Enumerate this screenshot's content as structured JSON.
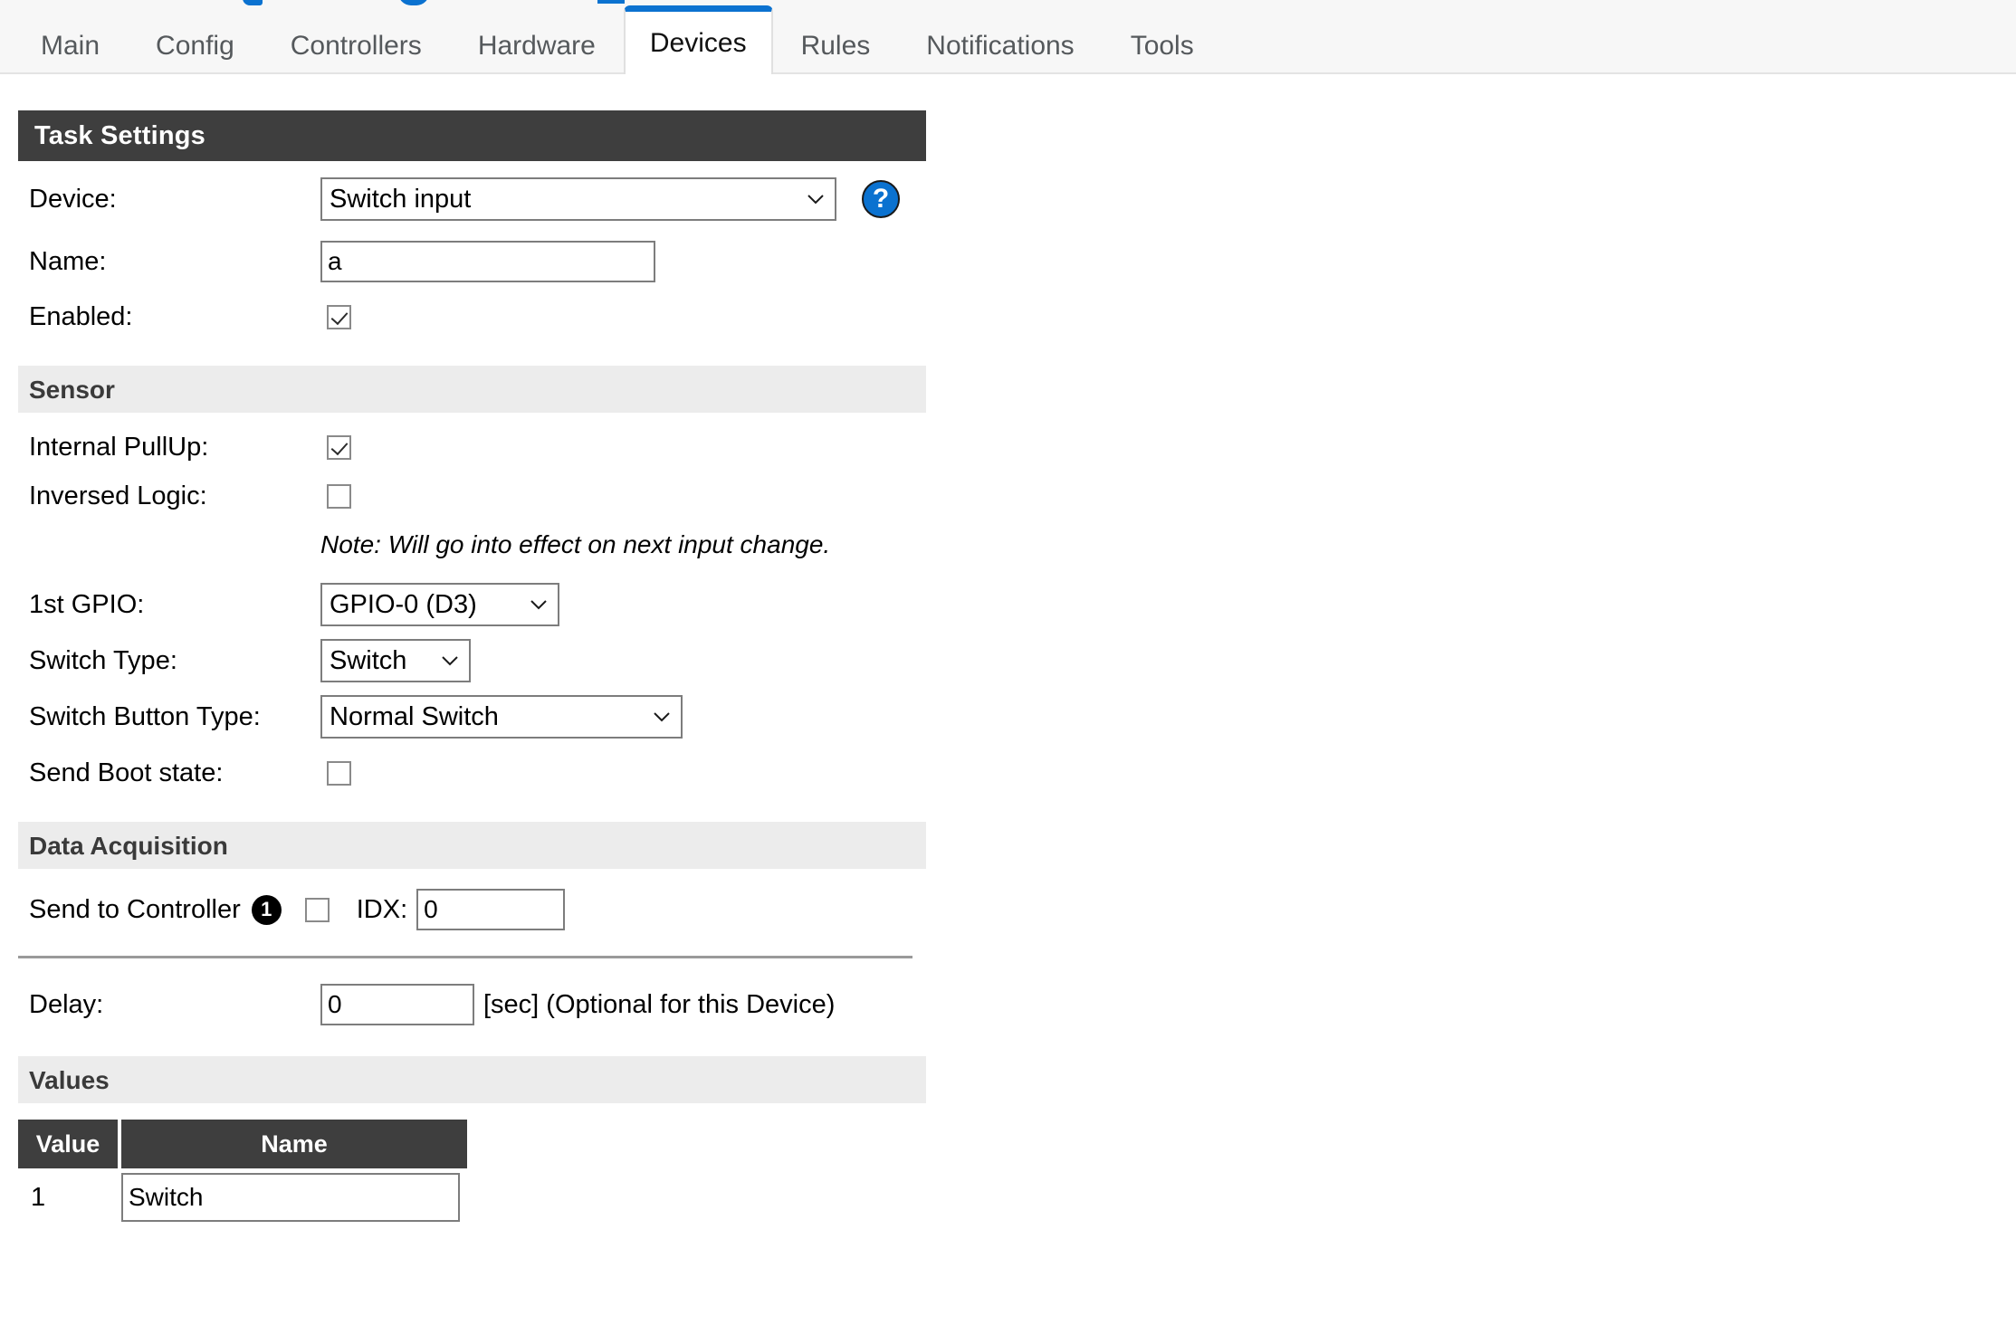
{
  "nav": {
    "tabs": [
      {
        "label": "Main",
        "active": false
      },
      {
        "label": "Config",
        "active": false
      },
      {
        "label": "Controllers",
        "active": false
      },
      {
        "label": "Hardware",
        "active": false
      },
      {
        "label": "Devices",
        "active": true
      },
      {
        "label": "Rules",
        "active": false
      },
      {
        "label": "Notifications",
        "active": false
      },
      {
        "label": "Tools",
        "active": false
      }
    ],
    "active_tab": "Devices",
    "accent_color": "#0b72d0"
  },
  "task_settings": {
    "header": "Task Settings",
    "device": {
      "label": "Device:",
      "value": "Switch input",
      "help_icon": "question-mark-icon"
    },
    "name": {
      "label": "Name:",
      "value": "a"
    },
    "enabled": {
      "label": "Enabled:",
      "checked": true
    }
  },
  "sensor": {
    "header": "Sensor",
    "internal_pullup": {
      "label": "Internal PullUp:",
      "checked": true
    },
    "inversed_logic": {
      "label": "Inversed Logic:",
      "checked": false
    },
    "note": "Note: Will go into effect on next input change.",
    "first_gpio": {
      "label": "1st GPIO:",
      "value": "GPIO-0 (D3)"
    },
    "switch_type": {
      "label": "Switch Type:",
      "value": "Switch"
    },
    "switch_button_type": {
      "label": "Switch Button Type:",
      "value": "Normal Switch"
    },
    "send_boot_state": {
      "label": "Send Boot state:",
      "checked": false
    }
  },
  "data_acquisition": {
    "header": "Data Acquisition",
    "send_to_controller": {
      "label": "Send to Controller",
      "badge": "1",
      "checked": false
    },
    "idx": {
      "label": "IDX:",
      "value": "0"
    },
    "delay": {
      "label": "Delay:",
      "value": "0",
      "unit": "[sec] (Optional for this Device)"
    }
  },
  "values": {
    "header": "Values",
    "columns": [
      "Value",
      "Name"
    ],
    "rows": [
      {
        "value": "1",
        "name": "Switch"
      }
    ]
  }
}
